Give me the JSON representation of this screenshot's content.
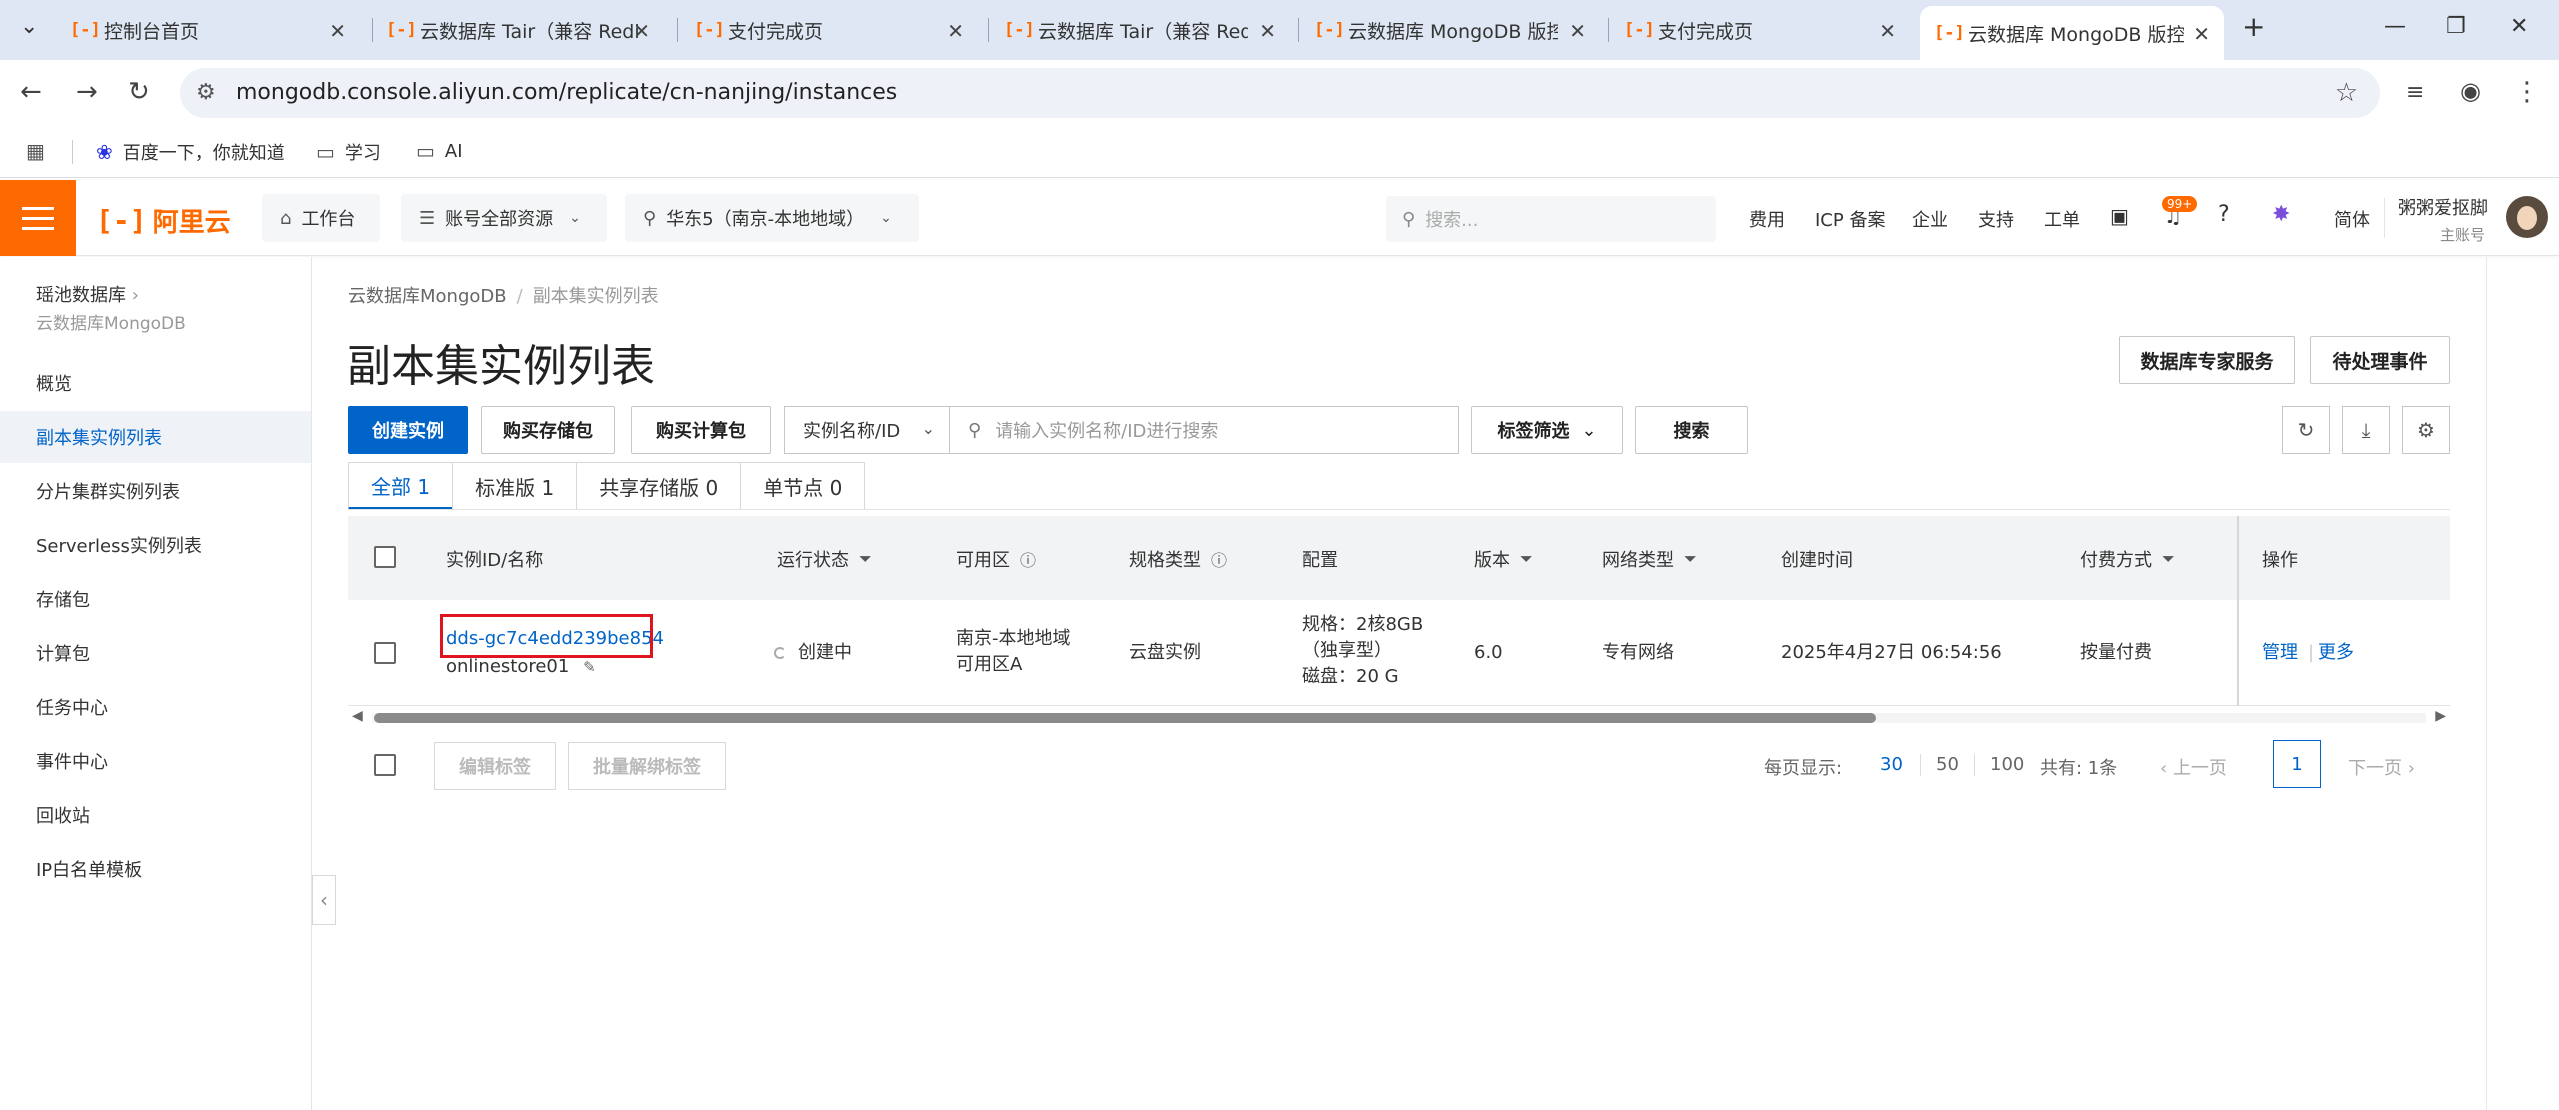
{
  "browser": {
    "tabs": [
      {
        "title": "控制台首页"
      },
      {
        "title": "云数据库 Tair（兼容 Redis"
      },
      {
        "title": "支付完成页"
      },
      {
        "title": "云数据库 Tair（兼容 Redis"
      },
      {
        "title": "云数据库 MongoDB 版控"
      },
      {
        "title": "支付完成页"
      },
      {
        "title": "云数据库 MongoDB 版控"
      }
    ],
    "url": "mongodb.console.aliyun.com/replicate/cn-nanjing/instances",
    "bookmarks": [
      {
        "label": "百度一下，你就知道"
      },
      {
        "label": "学习"
      },
      {
        "label": "AI"
      }
    ]
  },
  "topnav": {
    "logo": "阿里云",
    "workbench": "工作台",
    "account": "账号全部资源",
    "region": "华东5（南京-本地地域）",
    "search_placeholder": "搜索...",
    "links": [
      "费用",
      "ICP 备案",
      "企业",
      "支持",
      "工单"
    ],
    "badge": "99+",
    "lang": "简体",
    "user_name": "粥粥爱抠脚",
    "user_sub": "主账号"
  },
  "sidebar": {
    "title": "瑶池数据库",
    "subtitle": "云数据库MongoDB",
    "items": [
      {
        "label": "概览"
      },
      {
        "label": "副本集实例列表"
      },
      {
        "label": "分片集群实例列表"
      },
      {
        "label": "Serverless实例列表"
      },
      {
        "label": "存储包"
      },
      {
        "label": "计算包"
      },
      {
        "label": "任务中心"
      },
      {
        "label": "事件中心"
      },
      {
        "label": "回收站"
      },
      {
        "label": "IP白名单模板"
      }
    ]
  },
  "main": {
    "breadcrumb": [
      "云数据库MongoDB",
      "副本集实例列表"
    ],
    "title": "副本集实例列表",
    "expert_btn": "数据库专家服务",
    "events_btn": "待处理事件",
    "toolbar": {
      "create": "创建实例",
      "buy_storage": "购买存储包",
      "buy_compute": "购买计算包",
      "search_field": "实例名称/ID",
      "search_placeholder": "请输入实例名称/ID进行搜索",
      "tag_filter": "标签筛选",
      "search": "搜索"
    },
    "tabs": [
      {
        "label": "全部 1"
      },
      {
        "label": "标准版 1"
      },
      {
        "label": "共享存储版 0"
      },
      {
        "label": "单节点 0"
      }
    ],
    "columns": [
      "实例ID/名称",
      "运行状态",
      "可用区",
      "规格类型",
      "配置",
      "版本",
      "网络类型",
      "创建时间",
      "付费方式",
      "操作"
    ],
    "row": {
      "id": "dds-gc7c4edd239be854",
      "name": "onlinestore01",
      "status": "创建中",
      "zone1": "南京-本地地域",
      "zone2": "可用区A",
      "spec_type": "云盘实例",
      "config1": "规格：2核8GB",
      "config2": "（独享型）",
      "config3": "磁盘：20 G",
      "version": "6.0",
      "network": "专有网络",
      "created": "2025年4月27日 06:54:56",
      "billing": "按量付费",
      "op_manage": "管理",
      "op_more": "更多"
    },
    "footer": {
      "edit_tags": "编辑标签",
      "unbind_tags": "批量解绑标签",
      "page_size_label": "每页显示:",
      "page_sizes": [
        "30",
        "50",
        "100"
      ],
      "total": "共有: 1条",
      "prev": "上一页",
      "current_page": "1",
      "next": "下一页"
    }
  }
}
